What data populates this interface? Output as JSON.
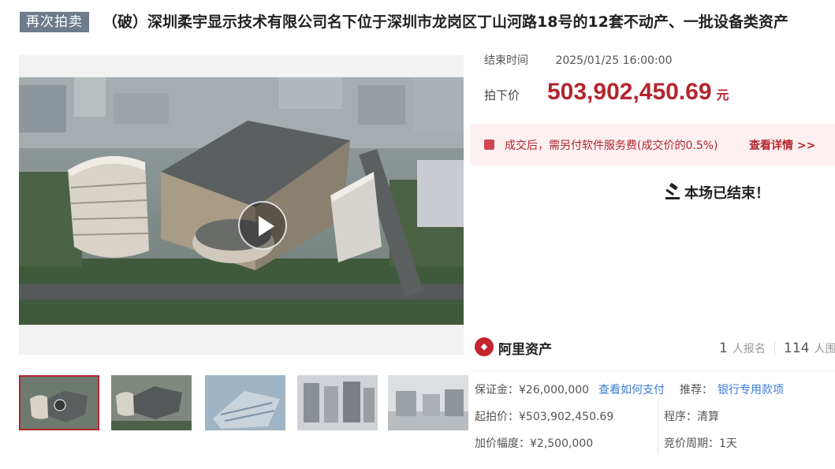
{
  "header": {
    "tag": "再次拍卖",
    "title": "（破）深圳柔宇显示技术有限公司名下位于深圳市龙岗区丁山河路18号的12套不动产、一批设备类资产"
  },
  "auction": {
    "end_label": "结束时间",
    "end_time": "2025/01/25 16:00:00",
    "price_label": "拍下价",
    "price": "503,902,450.69",
    "price_unit": "元",
    "fee_note": "成交后，需另付软件服务费(成交价的0.5%)",
    "fee_link": "查看详情 >>",
    "ended_text": "本场已结束！"
  },
  "platform": {
    "name": "阿里资产",
    "signup_count": "1",
    "signup_label": "人报名",
    "views_count": "114",
    "views_label": "人围"
  },
  "details": {
    "deposit": "保证金：¥26,000,000",
    "pay_link": "查看如何支付",
    "recommend_label": "推荐：",
    "recommend_value": "银行专用款项",
    "start_price": "起拍价：¥503,902,450.69",
    "procedure": "程序：清算",
    "increment": "加价幅度：¥2,500,000",
    "cycle": "竞价周期：1天"
  },
  "colors": {
    "accent": "#b3262e",
    "link": "#3a7bd5",
    "tag_bg": "#6e7b8c"
  },
  "icons": [
    "play-icon",
    "fee-icon",
    "gavel-icon",
    "ali-asset-logo"
  ]
}
